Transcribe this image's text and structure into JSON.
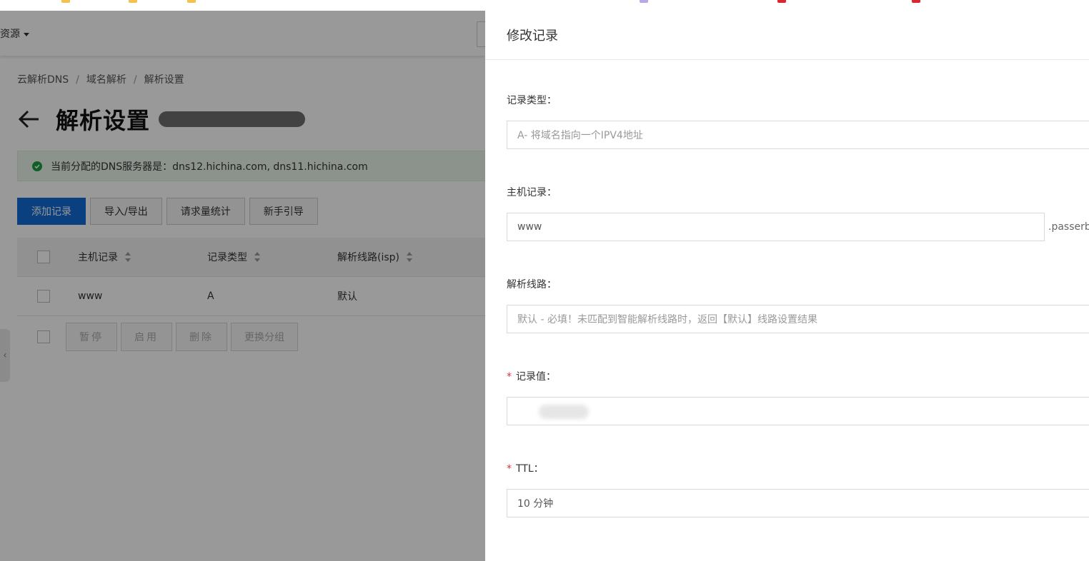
{
  "topbar": {
    "resource_menu": "资源"
  },
  "breadcrumb": {
    "items": [
      "云解析DNS",
      "域名解析",
      "解析设置"
    ]
  },
  "page": {
    "title": "解析设置"
  },
  "notice": {
    "text": "当前分配的DNS服务器是：dns12.hichina.com, dns11.hichina.com"
  },
  "actions": {
    "add": "添加记录",
    "import_export": "导入/导出",
    "stats": "请求量统计",
    "guide": "新手引导"
  },
  "table": {
    "columns": [
      "主机记录",
      "记录类型",
      "解析线路(isp)"
    ],
    "rows": [
      {
        "host": "www",
        "type": "A",
        "line": "默认"
      }
    ]
  },
  "batch": {
    "pause": "暂停",
    "enable": "启用",
    "delete": "删除",
    "group": "更换分组"
  },
  "drawer": {
    "title": "修改记录",
    "record_type": {
      "label": "记录类型：",
      "value": "A- 将域名指向一个IPV4地址"
    },
    "host": {
      "label": "主机记录：",
      "value": "www",
      "suffix": ".passerby"
    },
    "line": {
      "label": "解析线路：",
      "value": "默认 - 必填！未匹配到智能解析线路时，返回【默认】线路设置结果"
    },
    "record_value": {
      "label": "记录值：",
      "required": "*"
    },
    "ttl": {
      "label": "TTL：",
      "required": "*",
      "value": "10 分钟"
    }
  },
  "colors": {
    "primary": "#1169d6",
    "success": "#1b9e3e",
    "required": "#e0313a"
  }
}
